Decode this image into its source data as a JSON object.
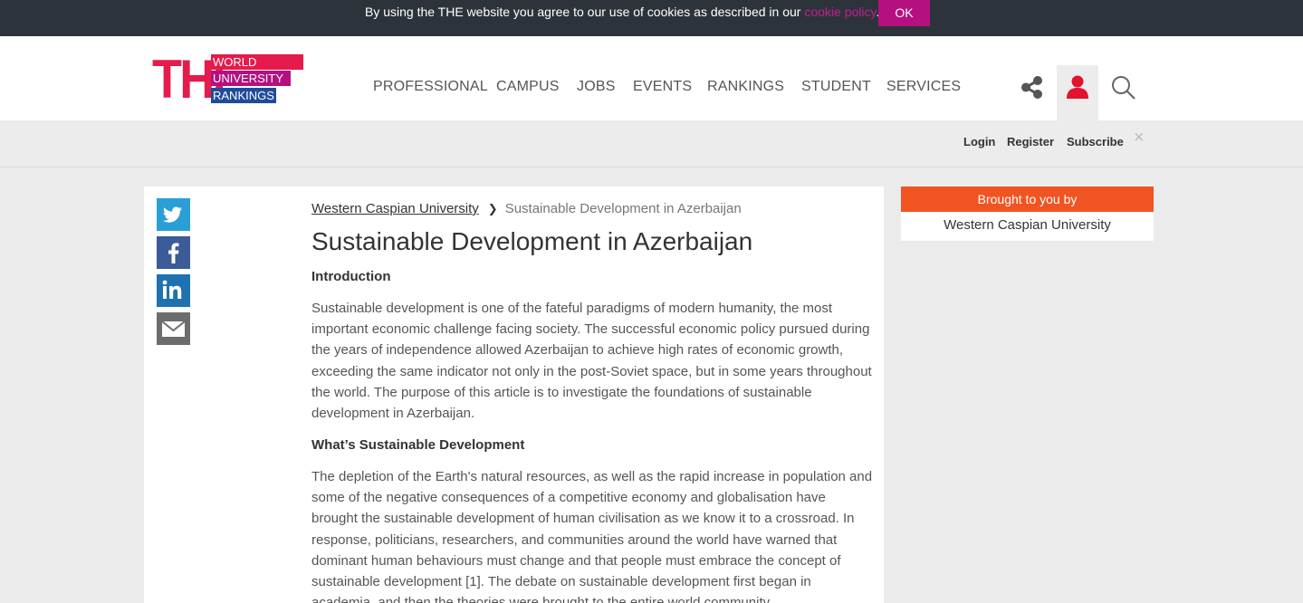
{
  "cookie": {
    "text_before": "By using the THE website you agree to our use of cookies as described in our ",
    "link": "cookie policy",
    "text_after": ".",
    "ok_label": "OK"
  },
  "logo": {
    "the": "THE",
    "line1": "WORLD",
    "line2": "UNIVERSITY",
    "line3": "RANKINGS"
  },
  "nav": {
    "items": [
      "PROFESSIONAL",
      "CAMPUS",
      "JOBS",
      "EVENTS",
      "RANKINGS",
      "STUDENT",
      "SERVICES"
    ]
  },
  "header_icons": [
    "share-icon",
    "user-icon",
    "search-icon"
  ],
  "subbar": {
    "login": "Login",
    "register": "Register",
    "subscribe": "Subscribe",
    "close": "×"
  },
  "social": [
    "twitter-icon",
    "facebook-icon",
    "linkedin-icon",
    "email-icon"
  ],
  "article": {
    "breadcrumb_parent": "Western Caspian University",
    "breadcrumb_current": "Sustainable Development in Azerbaijan",
    "title": "Sustainable Development in Azerbaijan",
    "intro_heading": "Introduction",
    "intro_paragraph": "Sustainable development is one of the fateful paradigms of modern humanity, the most important economic challenge facing society. The successful economic policy pursued during the years of independence allowed Azerbaijan to achieve high rates of economic growth, exceeding the same indicator not only in the post-Soviet space, but in some years throughout the world. The purpose of this article is to investigate the foundations of sustainable development in Azerbaijan.",
    "what_heading": "What’s Sustainable Development",
    "what_paragraph": "The depletion of the Earth's natural resources, as well as the rapid increase in population and some of the negative consequences of a competitive economy and globalisation have brought the sustainable development of human civilisation as we know it to a crossroad. In response, politicians, researchers, and communities around the world have warned that dominant human behaviours must change and that people must embrace the concept of sustainable development [1]. The debate on sustainable development first began in academia, and then the theories were brought to the entire world community"
  },
  "sponsor": {
    "heading": "Brought to you by",
    "name": "Western Caspian University"
  },
  "colors": {
    "cookie_bar": "#2d333b",
    "accent_magenta": "#b5107f",
    "brand_red": "#e51b4b",
    "sponsor_orange": "#f05423"
  }
}
